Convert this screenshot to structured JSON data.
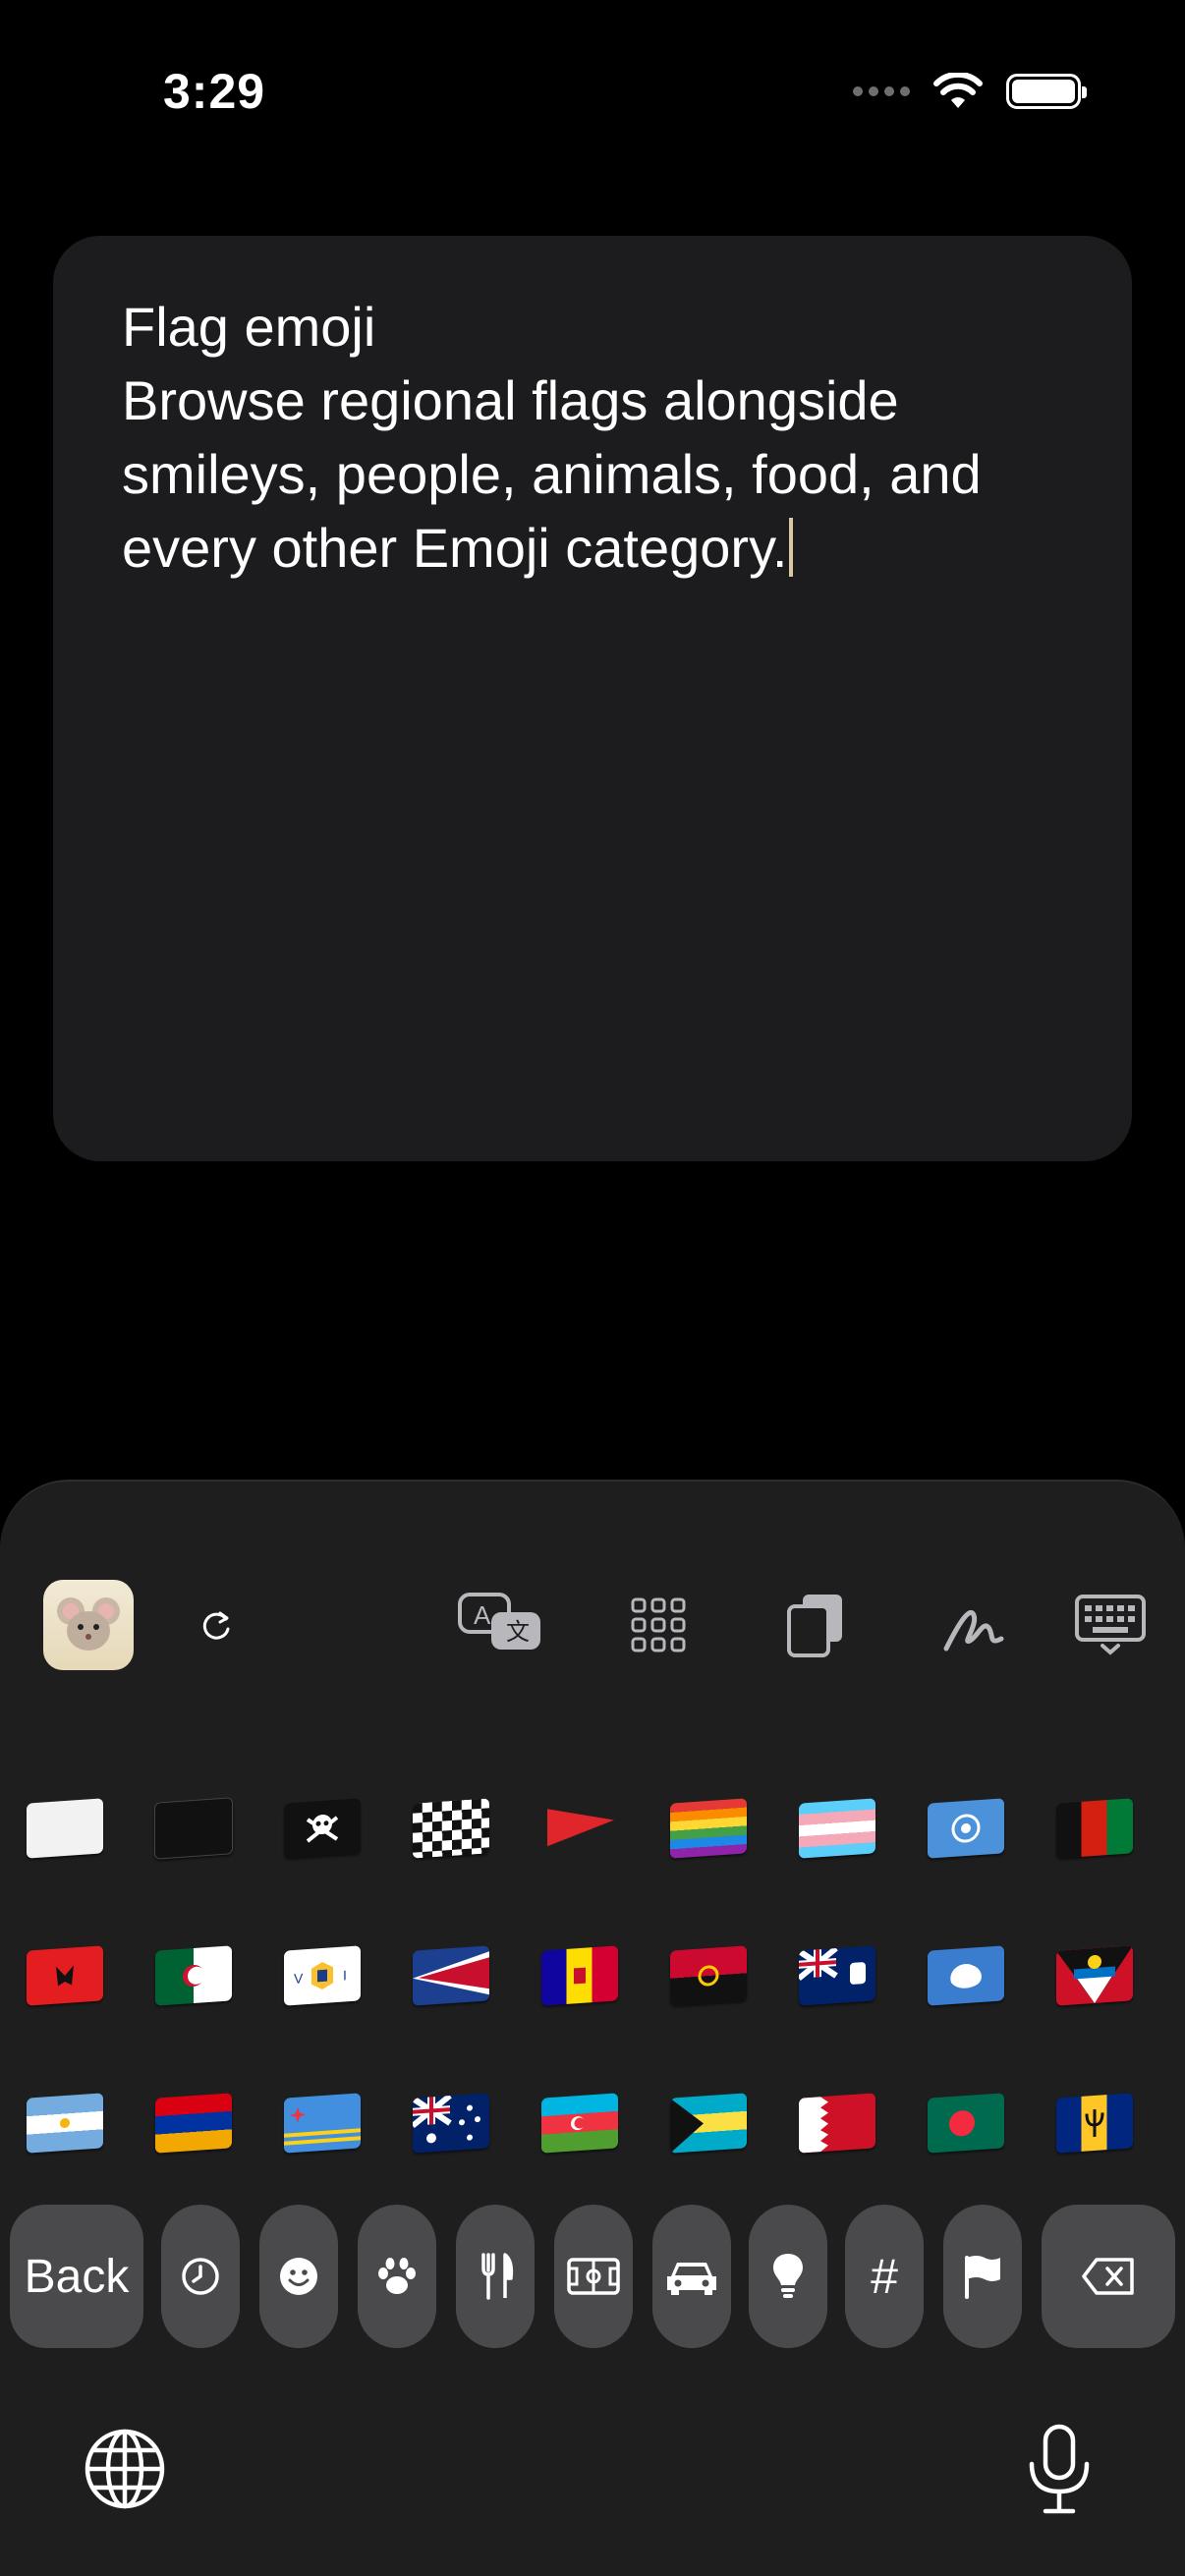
{
  "status_bar": {
    "time": "3:29"
  },
  "note": {
    "lines": [
      "Flag emoji",
      "Browse regional flags alongside",
      "smileys, people, animals, food, and",
      "every other Emoji category."
    ]
  },
  "toolbar": {
    "items": [
      "app-icon",
      "refresh-icon",
      "translate-icon",
      "grid-icon",
      "clipboard-icon",
      "handwriting-icon",
      "keyboard-dismiss-icon"
    ]
  },
  "emoji_rows": [
    [
      "white flag",
      "black flag",
      "pirate flag",
      "chequered flag",
      "triangular flag",
      "rainbow flag",
      "transgender flag",
      "United Nations",
      "Afghanistan"
    ],
    [
      "Albania",
      "Algeria",
      "U.S. Virgin Islands",
      "American Samoa",
      "Andorra",
      "Angola",
      "Anguilla",
      "Antarctica",
      "Antigua & Barbuda"
    ],
    [
      "Argentina",
      "Armenia",
      "Aruba",
      "Australia",
      "Azerbaijan",
      "Bahamas",
      "Bahrain",
      "Bangladesh",
      "Barbados"
    ]
  ],
  "category_bar": {
    "back_label": "Back",
    "categories": [
      "recent-icon",
      "smiley-icon",
      "paw-icon",
      "utensils-icon",
      "activity-icon",
      "car-icon",
      "lightbulb-icon",
      "symbols-icon",
      "flag-icon"
    ],
    "symbols_label": "#"
  },
  "colors": {
    "key_bg": "#4a4a4c",
    "keyboard_bg": "#1e1e1f",
    "card_bg": "#1c1c1e"
  }
}
